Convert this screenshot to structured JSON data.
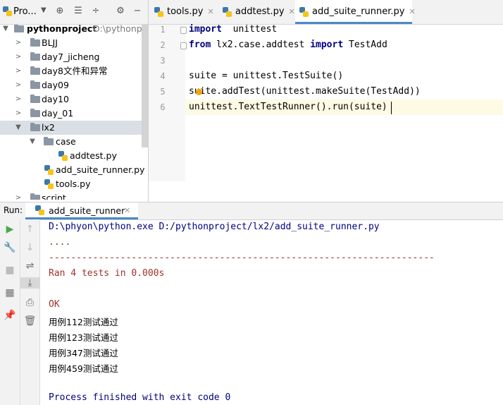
{
  "project_panel": {
    "title": "Pro...",
    "tree": [
      {
        "label": "pythonproject",
        "path": "D:\\pythonpro"
      },
      {
        "label": "BLJJ"
      },
      {
        "label": "day7_jicheng"
      },
      {
        "label": "day8文件和异常"
      },
      {
        "label": "day09"
      },
      {
        "label": "day10"
      },
      {
        "label": "day_01"
      },
      {
        "label": "lx2"
      },
      {
        "label": "case"
      },
      {
        "label": "addtest.py"
      },
      {
        "label": "add_suite_runner.py"
      },
      {
        "label": "tools.py"
      },
      {
        "label": "script"
      }
    ]
  },
  "tabs": [
    {
      "label": "tools.py"
    },
    {
      "label": "addtest.py"
    },
    {
      "label": "add_suite_runner.py"
    }
  ],
  "editor": {
    "line_numbers": [
      "1",
      "2",
      "3",
      "4",
      "5",
      "6"
    ],
    "lines": {
      "l1_kw": "import",
      "l1_rest": "  unittest",
      "l2_kw": "from",
      "l2_mid": " lx2.case.addtest ",
      "l2_kw2": "import",
      "l2_rest": " TestAdd",
      "l4": "suite = unittest.TestSuite()",
      "l5": "suite.addTest(unittest.makeSuite(TestAdd))",
      "l6": "unittest.TextTestRunner().run(suite)"
    }
  },
  "run_panel": {
    "label": "Run:",
    "tab": "add_suite_runner",
    "output": [
      "D:\\phyon\\python.exe D:/pythonproject/lx2/add_suite_runner.py",
      "....",
      "----------------------------------------------------------------------",
      "Ran 4 tests in 0.000s",
      "OK",
      "用例112测试通过",
      "用例123测试通过",
      "用例347测试通过",
      "用例459测试通过",
      "Process finished with exit code 0"
    ]
  },
  "colors": {
    "path": "#000080",
    "error": "#a0322b",
    "process": "#000080"
  }
}
